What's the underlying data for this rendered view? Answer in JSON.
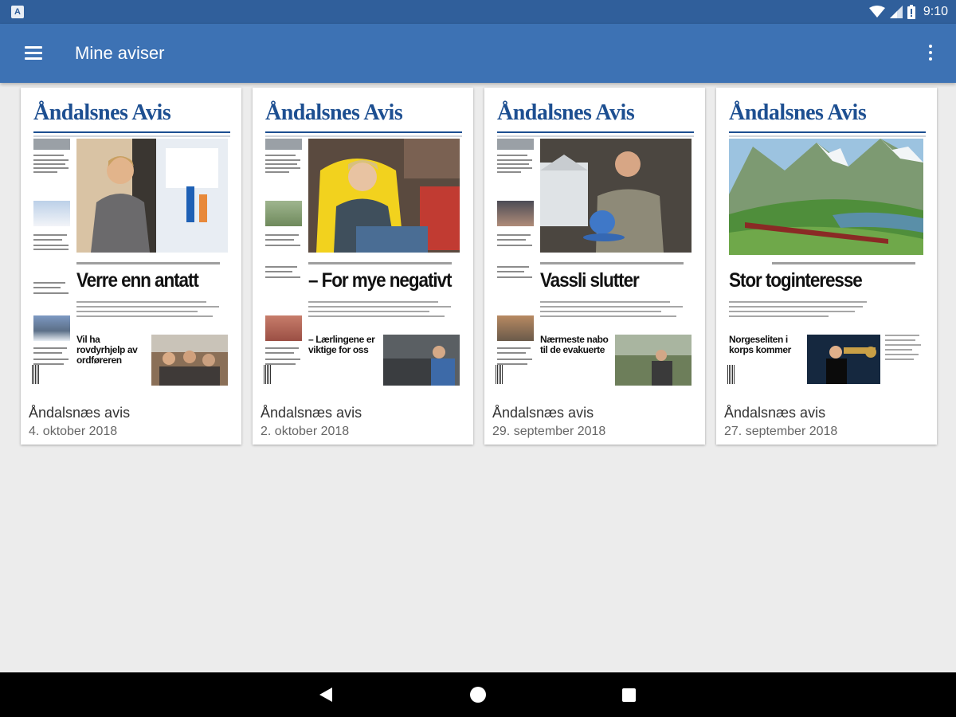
{
  "status_bar": {
    "time": "9:10",
    "icons": [
      "app-notification-icon",
      "wifi-icon",
      "signal-icon",
      "battery-icon"
    ]
  },
  "app_bar": {
    "title": "Mine aviser",
    "menu_icon": "hamburger-menu-icon",
    "more_icon": "more-vert-icon"
  },
  "colors": {
    "status_bar": "#305f9b",
    "app_bar": "#3d72b4",
    "background": "#ececec",
    "masthead": "#1d4f91"
  },
  "newspapers": [
    {
      "title": "Åndalsnæs avis",
      "date": "4. oktober 2018",
      "masthead": "Åndalsnes Avis",
      "headline": "Verre enn antatt",
      "subheadline": "Vil ha rovdyrhjelp av ordføreren"
    },
    {
      "title": "Åndalsnæs avis",
      "date": "2. oktober 2018",
      "masthead": "Åndalsnes Avis",
      "headline": "– For mye negativt",
      "subheadline": "– Lærlingene er viktige for oss"
    },
    {
      "title": "Åndalsnæs avis",
      "date": "29. september 2018",
      "masthead": "Åndalsnes Avis",
      "headline": "Vassli slutter",
      "subheadline": "Nærmeste nabo til de evakuerte"
    },
    {
      "title": "Åndalsnæs avis",
      "date": "27. september 2018",
      "masthead": "Åndalsnes Avis",
      "headline": "Stor toginteresse",
      "subheadline": "Norgeseliten i korps kommer"
    }
  ],
  "nav_bar": {
    "back_icon": "back-triangle-icon",
    "home_icon": "home-circle-icon",
    "recents_icon": "recents-square-icon"
  }
}
